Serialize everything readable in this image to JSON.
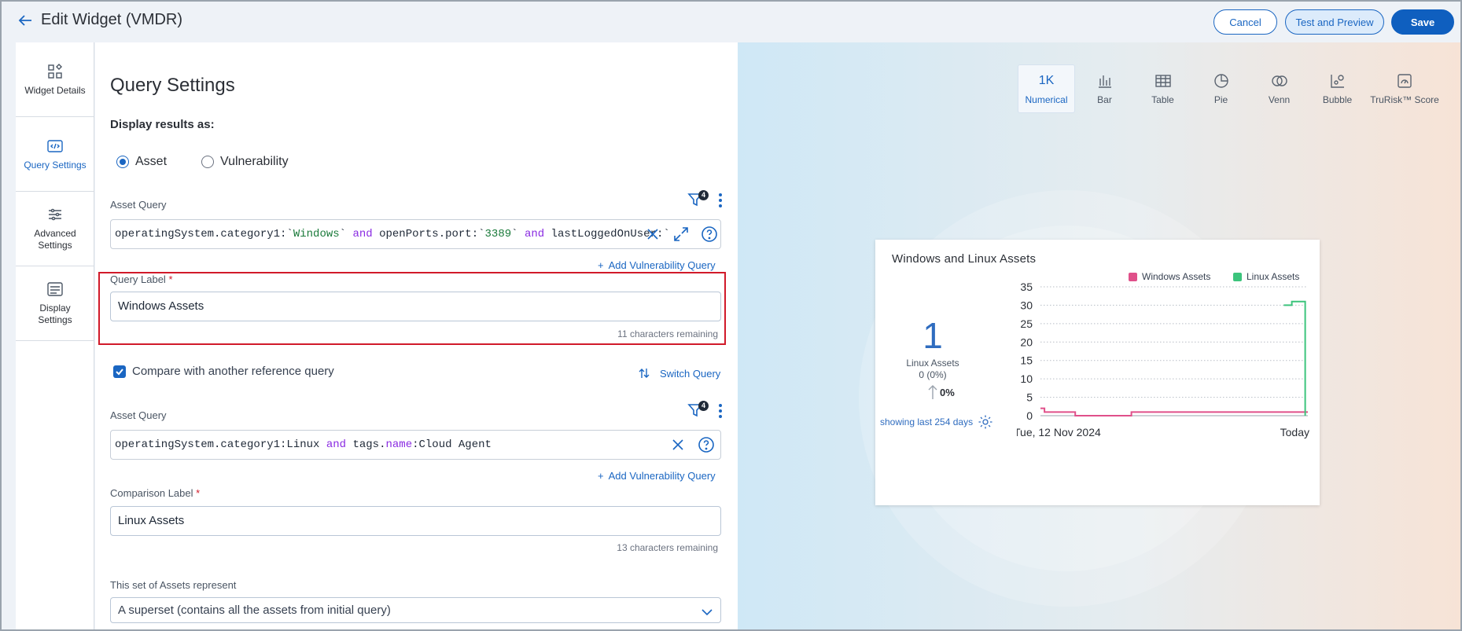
{
  "header": {
    "title": "Edit Widget (VMDR)",
    "cancel_label": "Cancel",
    "test_label": "Test and Preview",
    "save_label": "Save"
  },
  "leftnav": {
    "items": [
      {
        "label": "Widget Details",
        "icon": "widget-details-icon",
        "active": false
      },
      {
        "label": "Query Settings",
        "icon": "code-icon",
        "active": true
      },
      {
        "label": "Advanced Settings",
        "icon": "sliders-icon",
        "active": false
      },
      {
        "label": "Display Settings",
        "icon": "display-icon",
        "active": false
      }
    ]
  },
  "main": {
    "heading": "Query Settings",
    "display_as_label": "Display results as:",
    "radio": [
      {
        "label": "Asset",
        "selected": true
      },
      {
        "label": "Vulnerability",
        "selected": false
      }
    ],
    "query1": {
      "label": "Asset Query",
      "filter_count": "4",
      "text": "operatingSystem.category1:`Windows` and openPorts.port:`3389` and lastLoggedOnUser:`",
      "add_link": "Add Vulnerability Query"
    },
    "query_label": {
      "label": "Query Label",
      "required_mark": "*",
      "value": "Windows Assets",
      "remaining": "11 characters remaining"
    },
    "compare": {
      "label": "Compare with another reference query",
      "checked": true,
      "switch_label": "Switch Query"
    },
    "query2": {
      "label": "Asset Query",
      "filter_count": "4",
      "text": "operatingSystem.category1:Linux and tags.name:Cloud Agent",
      "add_link": "Add Vulnerability Query"
    },
    "comparison_label": {
      "label": "Comparison Label",
      "required_mark": "*",
      "value": "Linux Assets",
      "remaining": "13 characters remaining"
    },
    "assets_represent": {
      "label": "This set of Assets represent",
      "selected": "A superset (contains all the assets from initial query)"
    }
  },
  "preview": {
    "tabs": [
      {
        "label": "Numerical",
        "glyph": "1K",
        "active": true
      },
      {
        "label": "Bar",
        "glyph": "bar-icon",
        "active": false
      },
      {
        "label": "Table",
        "glyph": "table-icon",
        "active": false
      },
      {
        "label": "Pie",
        "glyph": "pie-icon",
        "active": false
      },
      {
        "label": "Venn",
        "glyph": "venn-icon",
        "active": false
      },
      {
        "label": "Bubble",
        "glyph": "bubble-icon",
        "active": false
      },
      {
        "label": "TruRisk™ Score",
        "glyph": "trurisk-icon",
        "active": false
      }
    ],
    "card": {
      "title": "Windows and Linux Assets",
      "value": "1",
      "value_label": "Linux Assets",
      "value_sub": "0 (0%)",
      "trend": "0%",
      "showing": "showing last 254 days"
    }
  },
  "colors": {
    "accent": "#1a66c2",
    "windows_series": "#e0508a",
    "linux_series": "#3cc47c",
    "highlight": "#d11a2a"
  },
  "chart_data": {
    "type": "line",
    "x_start_label": "Tue, 12 Nov 2024",
    "x_end_label": "Today",
    "yticks": [
      0,
      5,
      10,
      15,
      20,
      25,
      30,
      35
    ],
    "ylim": [
      0,
      35
    ],
    "legend_placement": "top-right",
    "grid": true,
    "series": [
      {
        "name": "Windows Assets",
        "color": "#e0508a",
        "step": true,
        "points": [
          [
            0,
            2
          ],
          [
            0.015,
            1
          ],
          [
            0.13,
            0
          ],
          [
            0.34,
            1
          ],
          [
            1,
            1
          ]
        ]
      },
      {
        "name": "Linux Assets",
        "color": "#3cc47c",
        "step": true,
        "points": [
          [
            0.91,
            30
          ],
          [
            0.94,
            31
          ],
          [
            0.99,
            31
          ],
          [
            0.99,
            0
          ]
        ]
      }
    ]
  }
}
